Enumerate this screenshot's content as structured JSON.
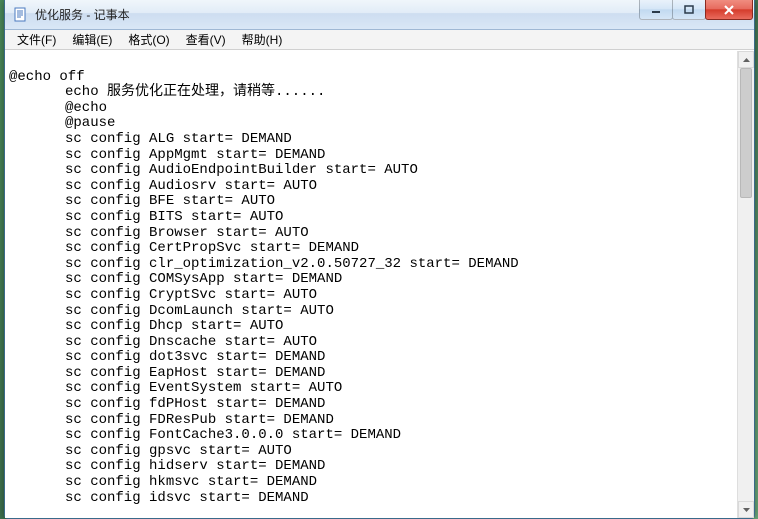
{
  "window": {
    "title": "优化服务 - 记事本"
  },
  "menu": {
    "file": "文件(F)",
    "edit": "编辑(E)",
    "format": "格式(O)",
    "view": "查看(V)",
    "help": "帮助(H)"
  },
  "document": {
    "line0": "@echo off",
    "lines": [
      "echo 服务优化正在处理，请稍等......",
      "@echo",
      "@pause",
      "sc config ALG start= DEMAND",
      "sc config AppMgmt start= DEMAND",
      "sc config AudioEndpointBuilder start= AUTO",
      "sc config Audiosrv start= AUTO",
      "sc config BFE start= AUTO",
      "sc config BITS start= AUTO",
      "sc config Browser start= AUTO",
      "sc config CertPropSvc start= DEMAND",
      "sc config clr_optimization_v2.0.50727_32 start= DEMAND",
      "sc config COMSysApp start= DEMAND",
      "sc config CryptSvc start= AUTO",
      "sc config DcomLaunch start= AUTO",
      "sc config Dhcp start= AUTO",
      "sc config Dnscache start= AUTO",
      "sc config dot3svc start= DEMAND",
      "sc config EapHost start= DEMAND",
      "sc config EventSystem start= AUTO",
      "sc config fdPHost start= DEMAND",
      "sc config FDResPub start= DEMAND",
      "sc config FontCache3.0.0.0 start= DEMAND",
      "sc config gpsvc start= AUTO",
      "sc config hidserv start= DEMAND",
      "sc config hkmsvc start= DEMAND",
      "sc config idsvc start= DEMAND"
    ]
  }
}
